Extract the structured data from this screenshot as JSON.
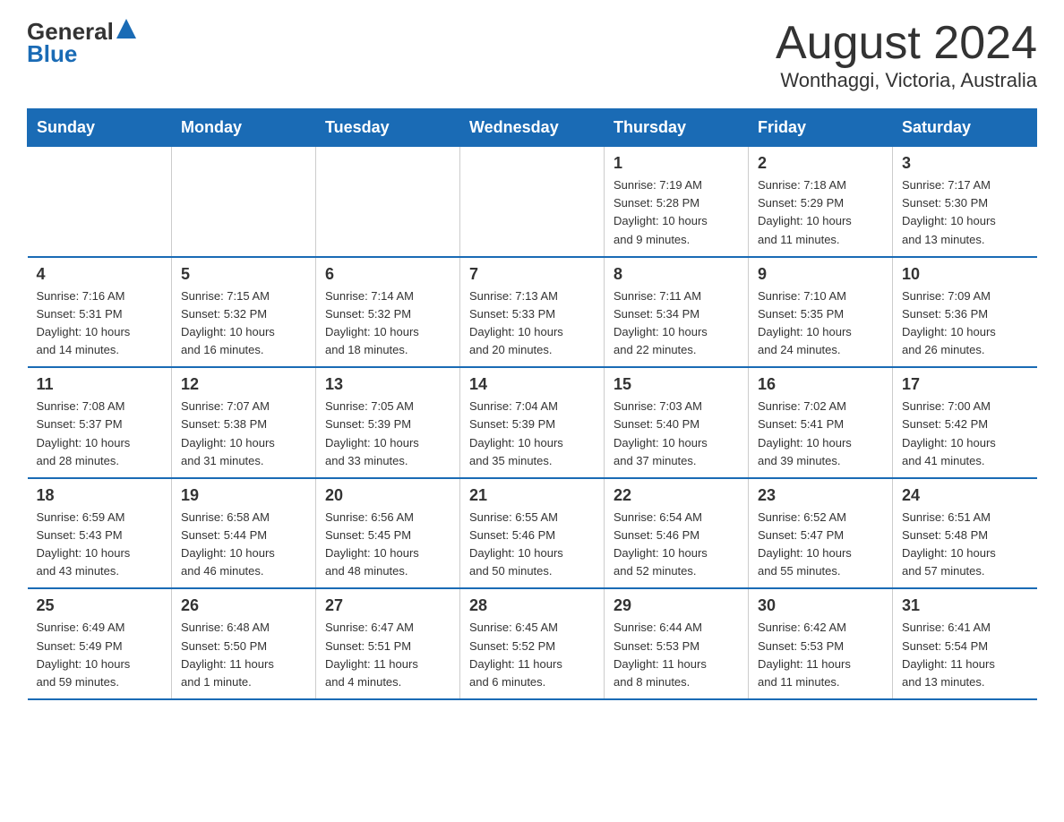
{
  "header": {
    "logo_general": "General",
    "logo_blue": "Blue",
    "title": "August 2024",
    "location": "Wonthaggi, Victoria, Australia"
  },
  "days_of_week": [
    "Sunday",
    "Monday",
    "Tuesday",
    "Wednesday",
    "Thursday",
    "Friday",
    "Saturday"
  ],
  "weeks": [
    [
      {
        "day": "",
        "info": ""
      },
      {
        "day": "",
        "info": ""
      },
      {
        "day": "",
        "info": ""
      },
      {
        "day": "",
        "info": ""
      },
      {
        "day": "1",
        "info": "Sunrise: 7:19 AM\nSunset: 5:28 PM\nDaylight: 10 hours\nand 9 minutes."
      },
      {
        "day": "2",
        "info": "Sunrise: 7:18 AM\nSunset: 5:29 PM\nDaylight: 10 hours\nand 11 minutes."
      },
      {
        "day": "3",
        "info": "Sunrise: 7:17 AM\nSunset: 5:30 PM\nDaylight: 10 hours\nand 13 minutes."
      }
    ],
    [
      {
        "day": "4",
        "info": "Sunrise: 7:16 AM\nSunset: 5:31 PM\nDaylight: 10 hours\nand 14 minutes."
      },
      {
        "day": "5",
        "info": "Sunrise: 7:15 AM\nSunset: 5:32 PM\nDaylight: 10 hours\nand 16 minutes."
      },
      {
        "day": "6",
        "info": "Sunrise: 7:14 AM\nSunset: 5:32 PM\nDaylight: 10 hours\nand 18 minutes."
      },
      {
        "day": "7",
        "info": "Sunrise: 7:13 AM\nSunset: 5:33 PM\nDaylight: 10 hours\nand 20 minutes."
      },
      {
        "day": "8",
        "info": "Sunrise: 7:11 AM\nSunset: 5:34 PM\nDaylight: 10 hours\nand 22 minutes."
      },
      {
        "day": "9",
        "info": "Sunrise: 7:10 AM\nSunset: 5:35 PM\nDaylight: 10 hours\nand 24 minutes."
      },
      {
        "day": "10",
        "info": "Sunrise: 7:09 AM\nSunset: 5:36 PM\nDaylight: 10 hours\nand 26 minutes."
      }
    ],
    [
      {
        "day": "11",
        "info": "Sunrise: 7:08 AM\nSunset: 5:37 PM\nDaylight: 10 hours\nand 28 minutes."
      },
      {
        "day": "12",
        "info": "Sunrise: 7:07 AM\nSunset: 5:38 PM\nDaylight: 10 hours\nand 31 minutes."
      },
      {
        "day": "13",
        "info": "Sunrise: 7:05 AM\nSunset: 5:39 PM\nDaylight: 10 hours\nand 33 minutes."
      },
      {
        "day": "14",
        "info": "Sunrise: 7:04 AM\nSunset: 5:39 PM\nDaylight: 10 hours\nand 35 minutes."
      },
      {
        "day": "15",
        "info": "Sunrise: 7:03 AM\nSunset: 5:40 PM\nDaylight: 10 hours\nand 37 minutes."
      },
      {
        "day": "16",
        "info": "Sunrise: 7:02 AM\nSunset: 5:41 PM\nDaylight: 10 hours\nand 39 minutes."
      },
      {
        "day": "17",
        "info": "Sunrise: 7:00 AM\nSunset: 5:42 PM\nDaylight: 10 hours\nand 41 minutes."
      }
    ],
    [
      {
        "day": "18",
        "info": "Sunrise: 6:59 AM\nSunset: 5:43 PM\nDaylight: 10 hours\nand 43 minutes."
      },
      {
        "day": "19",
        "info": "Sunrise: 6:58 AM\nSunset: 5:44 PM\nDaylight: 10 hours\nand 46 minutes."
      },
      {
        "day": "20",
        "info": "Sunrise: 6:56 AM\nSunset: 5:45 PM\nDaylight: 10 hours\nand 48 minutes."
      },
      {
        "day": "21",
        "info": "Sunrise: 6:55 AM\nSunset: 5:46 PM\nDaylight: 10 hours\nand 50 minutes."
      },
      {
        "day": "22",
        "info": "Sunrise: 6:54 AM\nSunset: 5:46 PM\nDaylight: 10 hours\nand 52 minutes."
      },
      {
        "day": "23",
        "info": "Sunrise: 6:52 AM\nSunset: 5:47 PM\nDaylight: 10 hours\nand 55 minutes."
      },
      {
        "day": "24",
        "info": "Sunrise: 6:51 AM\nSunset: 5:48 PM\nDaylight: 10 hours\nand 57 minutes."
      }
    ],
    [
      {
        "day": "25",
        "info": "Sunrise: 6:49 AM\nSunset: 5:49 PM\nDaylight: 10 hours\nand 59 minutes."
      },
      {
        "day": "26",
        "info": "Sunrise: 6:48 AM\nSunset: 5:50 PM\nDaylight: 11 hours\nand 1 minute."
      },
      {
        "day": "27",
        "info": "Sunrise: 6:47 AM\nSunset: 5:51 PM\nDaylight: 11 hours\nand 4 minutes."
      },
      {
        "day": "28",
        "info": "Sunrise: 6:45 AM\nSunset: 5:52 PM\nDaylight: 11 hours\nand 6 minutes."
      },
      {
        "day": "29",
        "info": "Sunrise: 6:44 AM\nSunset: 5:53 PM\nDaylight: 11 hours\nand 8 minutes."
      },
      {
        "day": "30",
        "info": "Sunrise: 6:42 AM\nSunset: 5:53 PM\nDaylight: 11 hours\nand 11 minutes."
      },
      {
        "day": "31",
        "info": "Sunrise: 6:41 AM\nSunset: 5:54 PM\nDaylight: 11 hours\nand 13 minutes."
      }
    ]
  ]
}
